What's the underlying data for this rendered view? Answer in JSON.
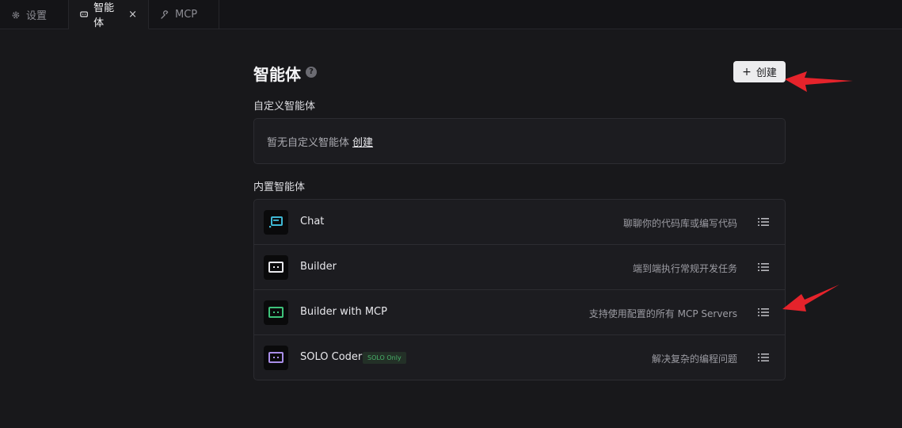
{
  "tabs": [
    {
      "label": "设置",
      "icon": "gear-icon"
    },
    {
      "label": "智能体",
      "icon": "robot-icon",
      "close": "×"
    },
    {
      "label": "MCP",
      "icon": "wrench-icon"
    }
  ],
  "page": {
    "title": "智能体",
    "help": "?",
    "create_label": "创建",
    "create_plus": "+"
  },
  "custom": {
    "label": "自定义智能体",
    "empty_text": "暂无自定义智能体",
    "empty_link": "创建"
  },
  "builtin": {
    "label": "内置智能体",
    "agents": [
      {
        "name": "Chat",
        "desc": "聊聊你的代码库或编写代码",
        "color": "#3fb8d4"
      },
      {
        "name": "Builder",
        "desc": "端到端执行常规开发任务",
        "color": "#e8e8ec"
      },
      {
        "name": "Builder with MCP",
        "desc": "支持使用配置的所有 MCP Servers",
        "color": "#3ec27a"
      },
      {
        "name": "SOLO Coder",
        "badge": "SOLO Only",
        "desc": "解决复杂的编程问题",
        "color": "#a98ee8"
      }
    ]
  },
  "colors": {
    "annotation_arrow": "#e5232b",
    "badge_green": "#48b26a"
  }
}
